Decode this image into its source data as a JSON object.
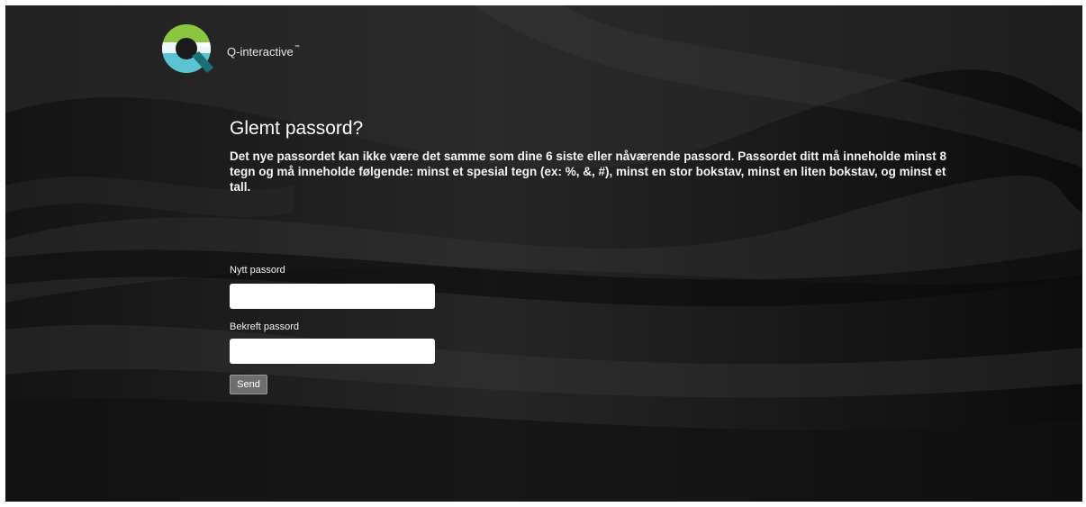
{
  "brand": {
    "logo_icon": "q-interactive-logo-icon",
    "name": "Q-interactive",
    "trademark": "™"
  },
  "page": {
    "title": "Glemt passord?",
    "description": "Det nye passordet kan ikke være det samme som dine 6 siste eller nåværende passord. Passordet ditt må inneholde minst 8 tegn og må inneholde følgende: minst et spesial tegn (ex: %, &, #), minst en stor bokstav, minst en liten bokstav, og minst et tall."
  },
  "form": {
    "new_password_label": "Nytt passord",
    "new_password_value": "",
    "confirm_password_label": "Bekreft passord",
    "confirm_password_value": "",
    "send_label": "Send"
  },
  "colors": {
    "background": "#1b1b1b",
    "logo_green": "#8cc63f",
    "logo_teal": "#5bc4d2",
    "logo_dark_teal": "#1e6f74"
  }
}
